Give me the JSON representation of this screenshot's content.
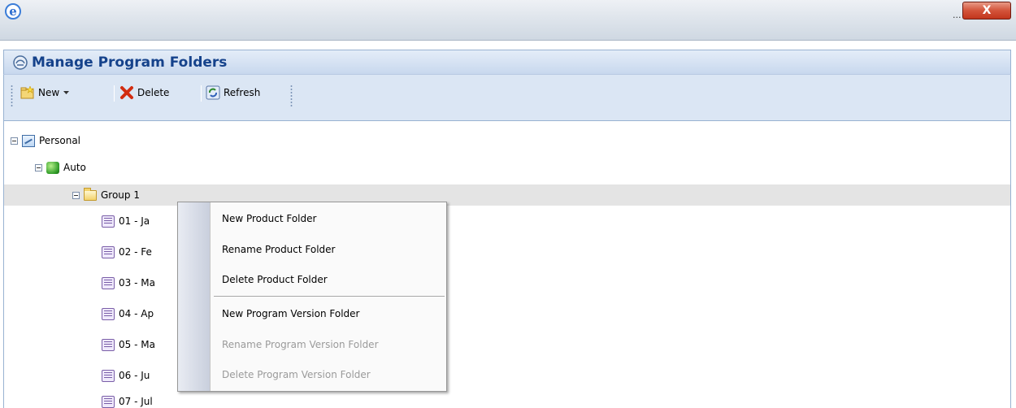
{
  "window": {
    "ellipsis": "...",
    "close_label": "X"
  },
  "panel": {
    "title": "Manage Program Folders"
  },
  "toolbar": {
    "new_label": "New",
    "delete_label": "Delete",
    "refresh_label": "Refresh"
  },
  "tree": {
    "root": "Personal",
    "product_line": "Auto",
    "group": "Group 1",
    "children": [
      "01 - Ja",
      "02 - Fe",
      "03 - Ma",
      "04 - Ap",
      "05 - Ma",
      "06 - Ju",
      "07 - Jul"
    ]
  },
  "context_menu": {
    "items": [
      {
        "label": "New Product Folder",
        "enabled": true
      },
      {
        "label": "Rename Product Folder",
        "enabled": true
      },
      {
        "label": "Delete Product Folder",
        "enabled": true
      },
      {
        "label": "New Program Version Folder",
        "enabled": true
      },
      {
        "label": "Rename Program Version Folder",
        "enabled": false
      },
      {
        "label": "Delete Program Version Folder",
        "enabled": false
      }
    ]
  },
  "colors": {
    "title_text": "#15428b",
    "header_bg": "#c8d8ee",
    "toolbar_bg": "#dbe6f4",
    "close_red": "#c2351c",
    "disabled_text": "#9a9a9a"
  },
  "icons": {
    "window": "internet-explorer-icon",
    "panel": "folders-icon",
    "new": "new-folder-icon",
    "delete": "red-x-icon",
    "refresh": "refresh-icon",
    "root": "network-icon",
    "product_line": "cube-icon",
    "group": "folder-icon",
    "child": "list-icon"
  }
}
